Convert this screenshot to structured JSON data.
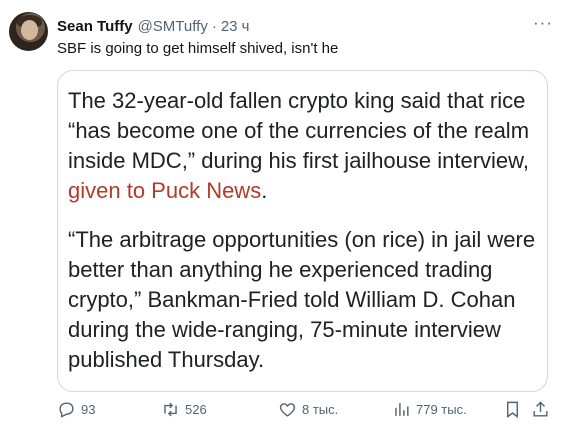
{
  "author": {
    "name": "Sean Tuffy",
    "handle": "@SMTuffy",
    "separator": "·",
    "time": "23 ч"
  },
  "more_label": "···",
  "tweet_text": "SBF is going to get himself shived, isn't he",
  "quote": {
    "paragraph1_before_link": "The 32-year-old fallen crypto king said that rice “has become one of the currencies of the realm inside MDC,” during his first jailhouse interview, ",
    "paragraph1_link": "given to Puck News",
    "paragraph1_after_link": ".",
    "paragraph2": "“The arbitrage opportunities (on rice) in jail were better than anything he experienced trading crypto,” Bankman-Fried told William D. Cohan during the wide-ranging, 75-minute interview published Thursday."
  },
  "actions": {
    "replies": "93",
    "retweets": "526",
    "likes": "8 тыс.",
    "views": "779 тыс."
  },
  "icons": {
    "reply": "reply-icon",
    "retweet": "retweet-icon",
    "like": "heart-icon",
    "views": "views-icon",
    "bookmark": "bookmark-icon",
    "share": "share-icon"
  }
}
